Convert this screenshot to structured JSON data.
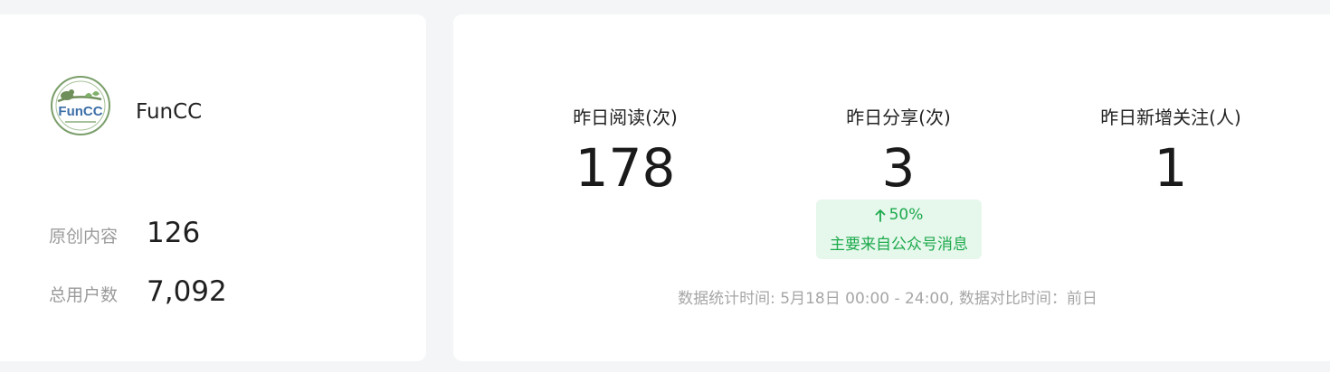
{
  "account": {
    "name": "FunCC",
    "logo_text": "FunCC"
  },
  "summary": {
    "original_label": "原创内容",
    "original_value": "126",
    "users_label": "总用户数",
    "users_value": "7,092"
  },
  "metrics": [
    {
      "label": "昨日阅读(次)",
      "value": "178"
    },
    {
      "label": "昨日分享(次)",
      "value": "3"
    },
    {
      "label": "昨日新增关注(人)",
      "value": "1"
    }
  ],
  "badge": {
    "change": "50%",
    "direction_icon": "arrow-up-icon",
    "note": "主要来自公众号消息",
    "color": "#1daa4c",
    "background": "#e6f7ec"
  },
  "footer": {
    "note": "数据统计时间: 5月18日 00:00 - 24:00, 数据对比时间：前日"
  }
}
